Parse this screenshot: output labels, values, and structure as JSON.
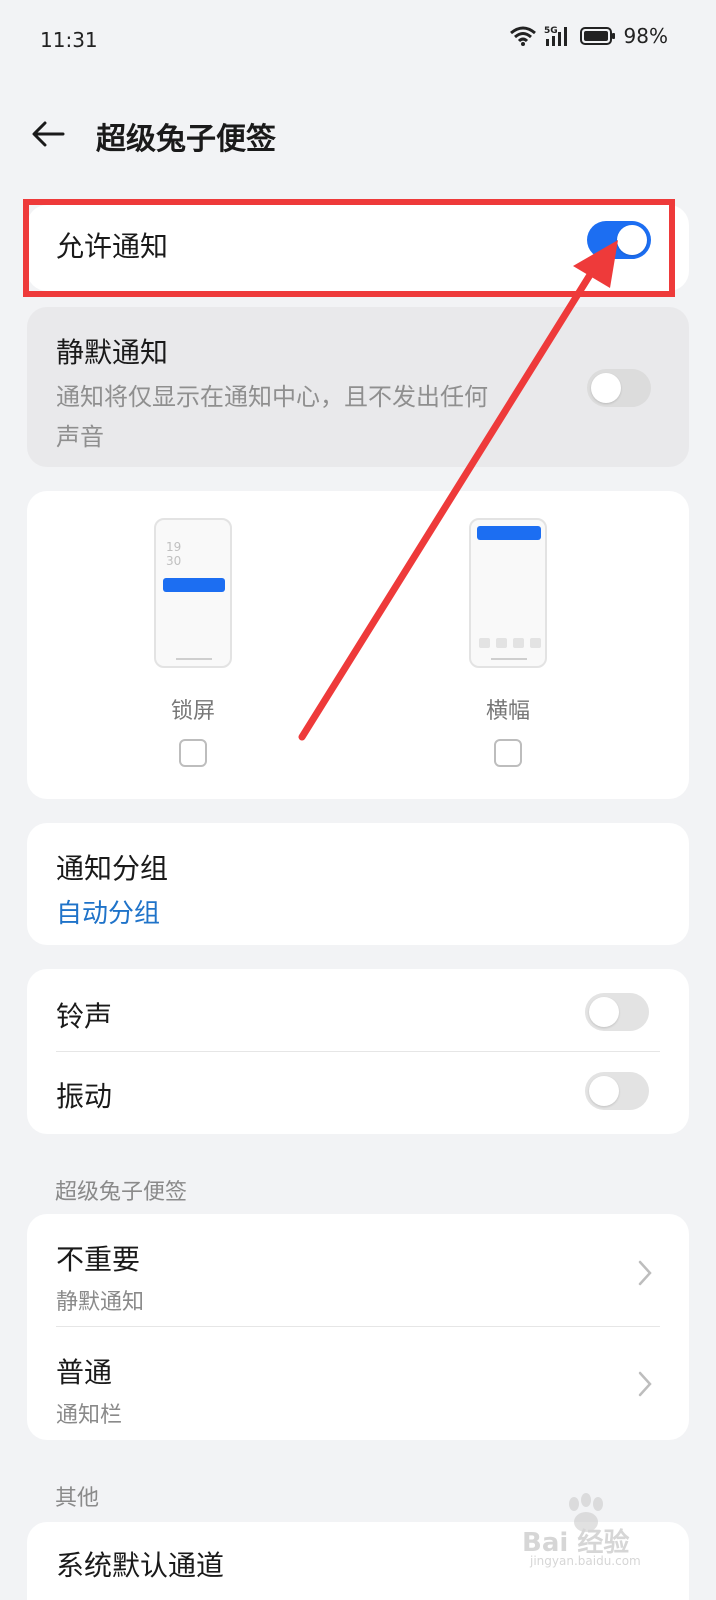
{
  "status_bar": {
    "time": "11:31",
    "battery": "98%"
  },
  "header": {
    "title": "超级兔子便签"
  },
  "allow_notify": {
    "label": "允许通知",
    "on": true
  },
  "silent_notify": {
    "label": "静默通知",
    "desc_line1": "通知将仅显示在通知中心，且不发出任何",
    "desc_line2": "声音",
    "on": false
  },
  "display_modes": {
    "lock_screen": {
      "label": "锁屏",
      "clock_top": "19",
      "clock_bottom": "30",
      "checked": false
    },
    "banner": {
      "label": "横幅",
      "checked": false
    }
  },
  "grouping": {
    "label": "通知分组",
    "value": "自动分组"
  },
  "sound": {
    "ringtone": {
      "label": "铃声",
      "on": false
    },
    "vibrate": {
      "label": "振动",
      "on": false
    }
  },
  "channels": {
    "section_label": "超级兔子便签",
    "items": [
      {
        "title": "不重要",
        "sub": "静默通知"
      },
      {
        "title": "普通",
        "sub": "通知栏"
      }
    ]
  },
  "other": {
    "section_label": "其他",
    "item": "系统默认通道"
  },
  "watermark": {
    "text": "Bai 经验",
    "url": "jingyan.baidu.com"
  },
  "colors": {
    "accent": "#1c6ef2",
    "annotation": "#ee3a3a",
    "link": "#1f73c9"
  }
}
